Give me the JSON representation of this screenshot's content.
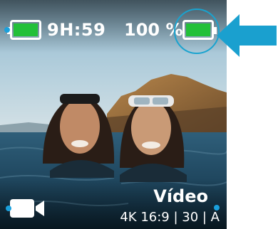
{
  "status": {
    "remaining_time": "9H:59",
    "battery_percent": "100 %",
    "battery_level": 1.0,
    "battery_color": "#22c039"
  },
  "mode": {
    "label": "Vídeo",
    "settings": "4K 16:9 | 30 | A",
    "icon": "video-camera-icon"
  },
  "annotation": {
    "arrow_color": "#1aa0cf",
    "highlight_color": "#19a3cf"
  }
}
